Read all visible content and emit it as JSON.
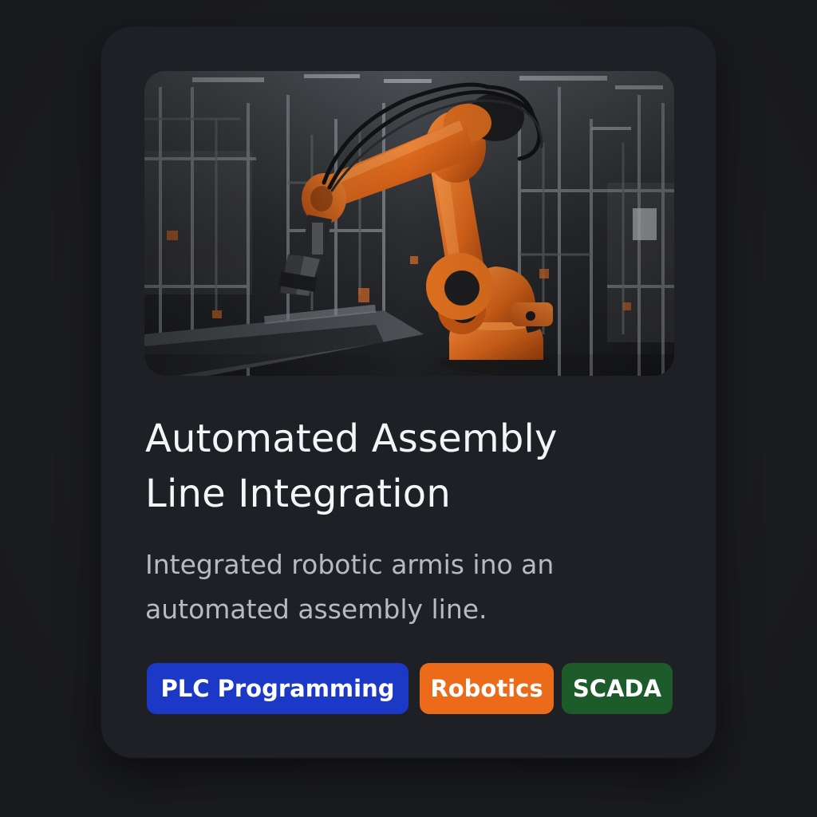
{
  "card": {
    "image_icon": "robotic-arm-factory-photo",
    "title_line1": "Automated Assembly",
    "title_line2": "Line Integration",
    "description_line1": "Integrated robotic armis ino an",
    "description_line2": "automated assembly line."
  },
  "tags": [
    {
      "label": "PLC Programming",
      "color": "#1b39c6"
    },
    {
      "label": "Robotics",
      "color": "#ec6b1a"
    },
    {
      "label": "SCADA",
      "color": "#1d5b2a"
    }
  ],
  "colors": {
    "background": "#1b1c1f",
    "card": "#1f2026",
    "title": "#f4f5f7",
    "description": "#b7bac3",
    "robot_orange": "#e06b1c"
  }
}
